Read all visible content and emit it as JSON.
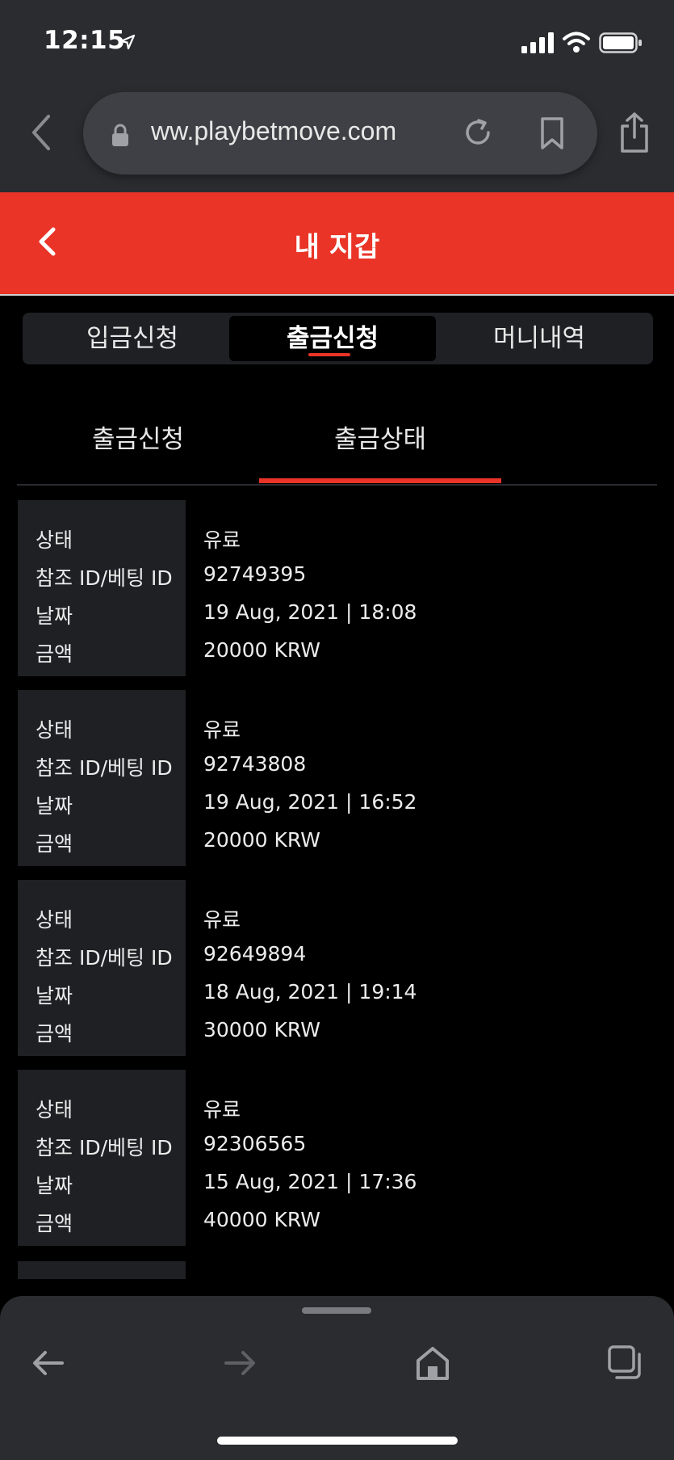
{
  "status": {
    "time": "12:15"
  },
  "browser": {
    "url": "ww.playbetmove.com"
  },
  "header": {
    "title": "내 지갑"
  },
  "main_tabs": [
    {
      "label": "입금신청",
      "active": false
    },
    {
      "label": "출금신청",
      "active": true
    },
    {
      "label": "머니내역",
      "active": false
    }
  ],
  "sub_tabs": [
    {
      "label": "출금신청",
      "active": false
    },
    {
      "label": "출금상태",
      "active": true
    }
  ],
  "field_labels": {
    "status": "상태",
    "ref_id": "참조 ID/베팅 ID",
    "date": "날짜",
    "amount": "금액"
  },
  "records": [
    {
      "status": "유료",
      "ref_id": "92749395",
      "date": "19 Aug, 2021 | 18:08",
      "amount": "20000 KRW"
    },
    {
      "status": "유료",
      "ref_id": "92743808",
      "date": "19 Aug, 2021 | 16:52",
      "amount": "20000 KRW"
    },
    {
      "status": "유료",
      "ref_id": "92649894",
      "date": "18 Aug, 2021 | 19:14",
      "amount": "30000 KRW"
    },
    {
      "status": "유료",
      "ref_id": "92306565",
      "date": "15 Aug, 2021 | 17:36",
      "amount": "40000 KRW"
    }
  ],
  "colors": {
    "accent": "#e93427",
    "panel": "#1f2024",
    "chrome": "#2b2c30"
  },
  "icons": {
    "browser": [
      "chevron-left-icon",
      "lock-icon",
      "reload-icon",
      "bookmark-icon",
      "share-icon"
    ],
    "toolbar": [
      "back-arrow-icon",
      "forward-arrow-icon",
      "home-icon",
      "tabs-icon"
    ]
  }
}
